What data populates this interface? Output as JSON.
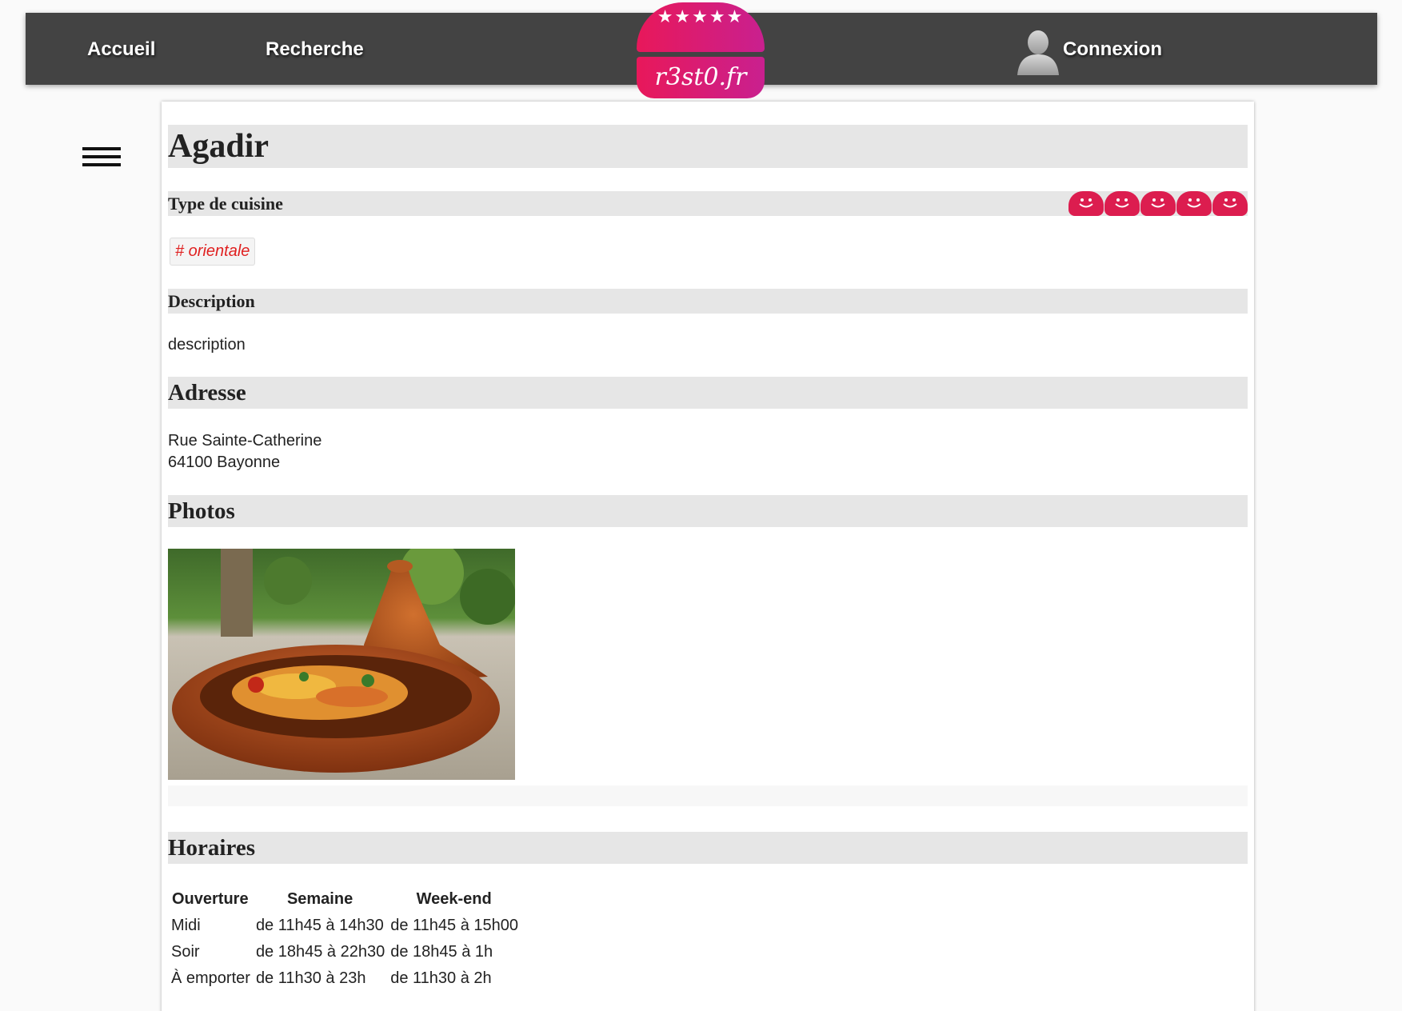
{
  "nav": {
    "accueil": "Accueil",
    "recherche": "Recherche",
    "connexion": "Connexion"
  },
  "logo": {
    "stars": "★★★★★",
    "text": "r3st0.fr"
  },
  "restaurant": {
    "name": "Agadir",
    "cuisine_heading": "Type de cuisine",
    "rating": 5,
    "rating_max": 5,
    "cuisine_tag": "# orientale",
    "description_heading": "Description",
    "description": "description",
    "address_heading": "Adresse",
    "address_line1": "Rue Sainte-Catherine",
    "address_line2": "64100 Bayonne",
    "photos_heading": "Photos",
    "hours_heading": "Horaires"
  },
  "hours": {
    "headers": [
      "Ouverture",
      "Semaine",
      "Week-end"
    ],
    "rows": [
      [
        "Midi",
        "de 11h45 à 14h30",
        "de 11h45 à 15h00"
      ],
      [
        "Soir",
        "de 18h45 à 22h30",
        "de 18h45 à 1h"
      ],
      [
        "À emporter",
        "de 11h30 à 23h",
        "de 11h30 à 2h"
      ]
    ]
  },
  "colors": {
    "topbar": "#434343",
    "brand": "#e8185a",
    "tag_text": "#e02020"
  },
  "icons": {
    "user": "user-silhouette-icon",
    "menu": "hamburger-icon",
    "rating": "smiley-icon"
  }
}
